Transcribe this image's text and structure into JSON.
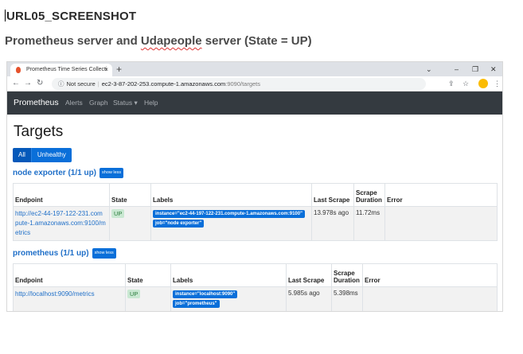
{
  "document": {
    "title": "URL05_SCREENSHOT",
    "subtitle_before": "Prometheus server and ",
    "subtitle_misspelled": "Udapeople",
    "subtitle_after": " server (State = UP)"
  },
  "browser": {
    "tab_title": "Prometheus Time Series Collecti",
    "tab_close": "×",
    "new_tab": "+",
    "window_controls": {
      "chevron": "⌄",
      "minimize": "–",
      "restore": "❐",
      "close": "✕"
    },
    "nav": {
      "back": "←",
      "forward": "→",
      "reload": "↻"
    },
    "address": {
      "info": "ⓘ",
      "security": "Not secure",
      "separator": "|",
      "host": "ec2-3-87-202-253.compute-1.amazonaws.com",
      "path": ":9090/targets"
    },
    "toolbar_icons": {
      "share": "⇪",
      "bookmark": "☆",
      "menu": "⋮"
    }
  },
  "app": {
    "brand": "Prometheus",
    "nav_items": [
      "Alerts",
      "Graph",
      "Status ▾",
      "Help"
    ]
  },
  "page": {
    "title": "Targets",
    "filters": [
      "All",
      "Unhealthy"
    ],
    "columns": [
      "Endpoint",
      "State",
      "Labels",
      "Last Scrape",
      "Scrape Duration",
      "Error"
    ]
  },
  "sections": [
    {
      "title": "node exporter (1/1 up)",
      "toggle": "show less",
      "endpoint_lines": [
        "http://ec2-44-197-122-231.com",
        "pute-1.amazonaws.com:9100/m",
        "etrics"
      ],
      "state": "UP",
      "labels": [
        "instance=\"ec2-44-197-122-231.compute-1.amazonaws.com:9100\"",
        "job=\"node exporter\""
      ],
      "last_scrape": "13.978s ago",
      "scrape_duration": "11.72ms",
      "error": ""
    },
    {
      "title": "prometheus (1/1 up)",
      "toggle": "show less",
      "endpoint_lines": [
        "http://localhost:9090/metrics"
      ],
      "state": "UP",
      "labels": [
        "instance=\"localhost:9090\"",
        "job=\"prometheus\""
      ],
      "last_scrape": "5.985s ago",
      "scrape_duration": "5.398ms",
      "error": ""
    }
  ]
}
